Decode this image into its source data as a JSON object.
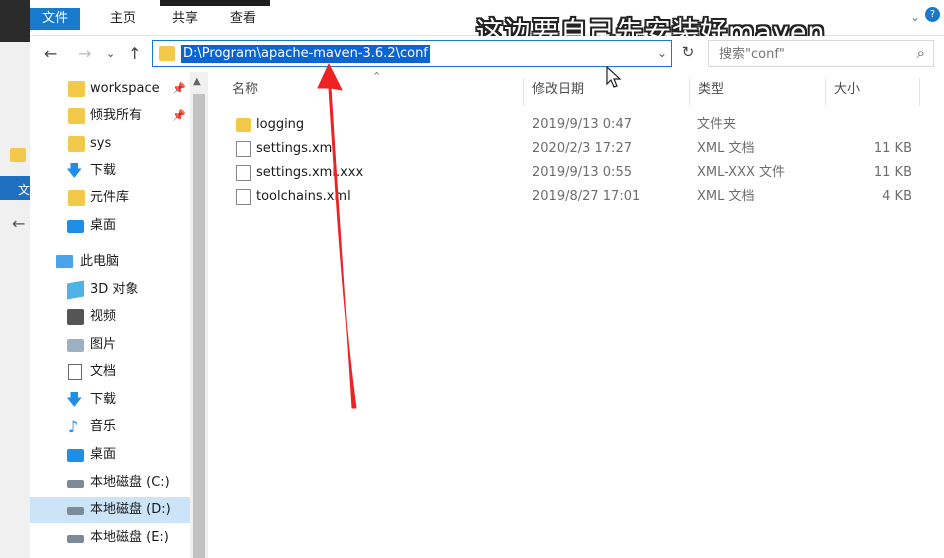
{
  "ribbon": {
    "tabs": [
      "文件",
      "主页",
      "共享",
      "查看"
    ]
  },
  "caption": "这边要自己先安装好maven",
  "bg_window": {
    "label": "文"
  },
  "address": {
    "path": "D:\\Program\\apache-maven-3.6.2\\conf"
  },
  "search": {
    "placeholder": "搜索\"conf\""
  },
  "nav": {
    "items": [
      {
        "label": "workspace",
        "icon": "folder-icon",
        "pinned": true
      },
      {
        "label": "倾我所有",
        "icon": "folder-icon",
        "pinned": true
      },
      {
        "label": "sys",
        "icon": "folder-icon",
        "pinned": false
      },
      {
        "label": "下载",
        "icon": "download-icon",
        "pinned": false
      },
      {
        "label": "元件库",
        "icon": "folder-icon",
        "pinned": false
      },
      {
        "label": "桌面",
        "icon": "desktop-icon",
        "pinned": false
      },
      {
        "label": "此电脑",
        "icon": "computer-icon",
        "pinned": false
      },
      {
        "label": "3D 对象",
        "icon": "cube-icon",
        "pinned": false
      },
      {
        "label": "视频",
        "icon": "video-icon",
        "pinned": false
      },
      {
        "label": "图片",
        "icon": "picture-icon",
        "pinned": false
      },
      {
        "label": "文档",
        "icon": "document-icon",
        "pinned": false
      },
      {
        "label": "下载",
        "icon": "download-icon",
        "pinned": false
      },
      {
        "label": "音乐",
        "icon": "music-icon",
        "pinned": false
      },
      {
        "label": "桌面",
        "icon": "desktop-icon",
        "pinned": false
      },
      {
        "label": "本地磁盘 (C:)",
        "icon": "drive-icon",
        "pinned": false
      },
      {
        "label": "本地磁盘 (D:)",
        "icon": "drive-icon",
        "pinned": false,
        "selected": true
      },
      {
        "label": "本地磁盘 (E:)",
        "icon": "drive-icon",
        "pinned": false
      }
    ]
  },
  "list": {
    "columns": [
      "名称",
      "修改日期",
      "类型",
      "大小"
    ],
    "rows": [
      {
        "name": "logging",
        "date": "2019/9/13 0:47",
        "type": "文件夹",
        "size": "",
        "kind": "folder"
      },
      {
        "name": "settings.xml",
        "date": "2020/2/3 17:27",
        "type": "XML 文档",
        "size": "11 KB",
        "kind": "file"
      },
      {
        "name": "settings.xml.xxx",
        "date": "2019/9/13 0:55",
        "type": "XML-XXX 文件",
        "size": "11 KB",
        "kind": "file"
      },
      {
        "name": "toolchains.xml",
        "date": "2019/8/27 17:01",
        "type": "XML 文档",
        "size": "4 KB",
        "kind": "file"
      }
    ]
  },
  "colors": {
    "accent": "#1979ca",
    "selection": "#cce4f7",
    "annotation_arrow": "#ee2222"
  }
}
